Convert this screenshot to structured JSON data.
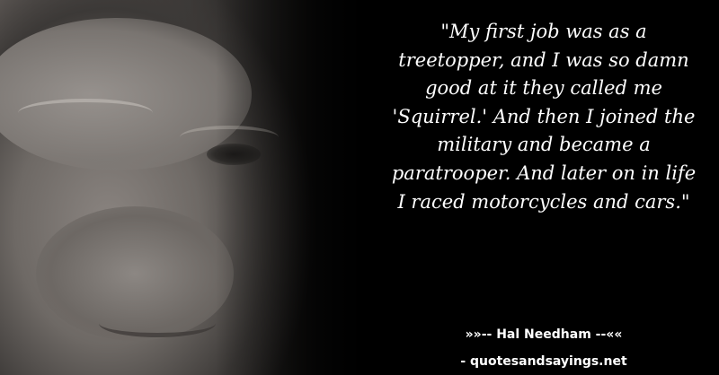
{
  "photo": {
    "subject": "portrait-photo"
  },
  "quote": {
    "text": "\"My first job was as a treetopper, and I was so damn good at it they called me 'Squirrel.' And then I joined the military and became a paratrooper. And later on in life I raced motorcycles and cars.\""
  },
  "attribution": {
    "author": "»»-- Hal Needham --««",
    "source": "- quotesandsayings.net"
  },
  "colors": {
    "background": "#000000",
    "text": "#ffffff"
  }
}
